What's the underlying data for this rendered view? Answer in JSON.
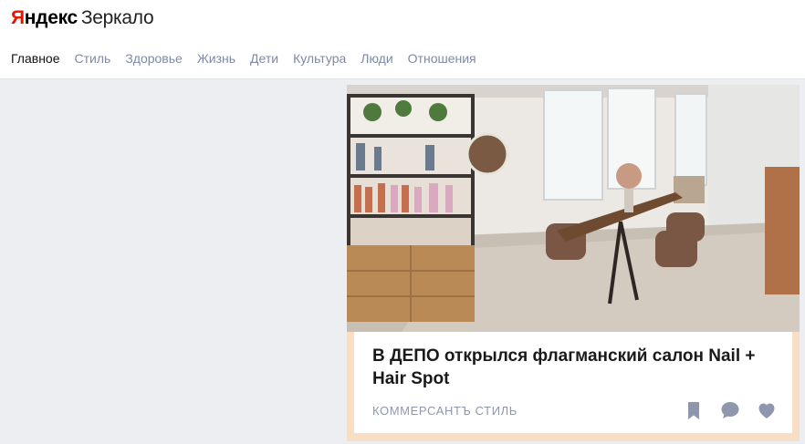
{
  "header": {
    "logo": {
      "part1": "Я",
      "part2": "ндекс",
      "name": "Зеркало"
    },
    "nav": [
      {
        "label": "Главное",
        "active": true
      },
      {
        "label": "Стиль",
        "active": false
      },
      {
        "label": "Здоровье",
        "active": false
      },
      {
        "label": "Жизнь",
        "active": false
      },
      {
        "label": "Дети",
        "active": false
      },
      {
        "label": "Культура",
        "active": false
      },
      {
        "label": "Люди",
        "active": false
      },
      {
        "label": "Отношения",
        "active": false
      }
    ]
  },
  "card": {
    "title": "В ДЕПО открылся флагманский салон Nail + Hair Spot",
    "source": "КОММЕРСАНТЪ СТИЛЬ",
    "actions": [
      "bookmark-icon",
      "comment-icon",
      "heart-icon"
    ]
  },
  "colors": {
    "brand_red": "#e61400",
    "nav_inactive": "#7d8aa6",
    "page_background": "#edeef2",
    "card_border": "#f7dec4",
    "icon_gray": "#8e97ad"
  }
}
